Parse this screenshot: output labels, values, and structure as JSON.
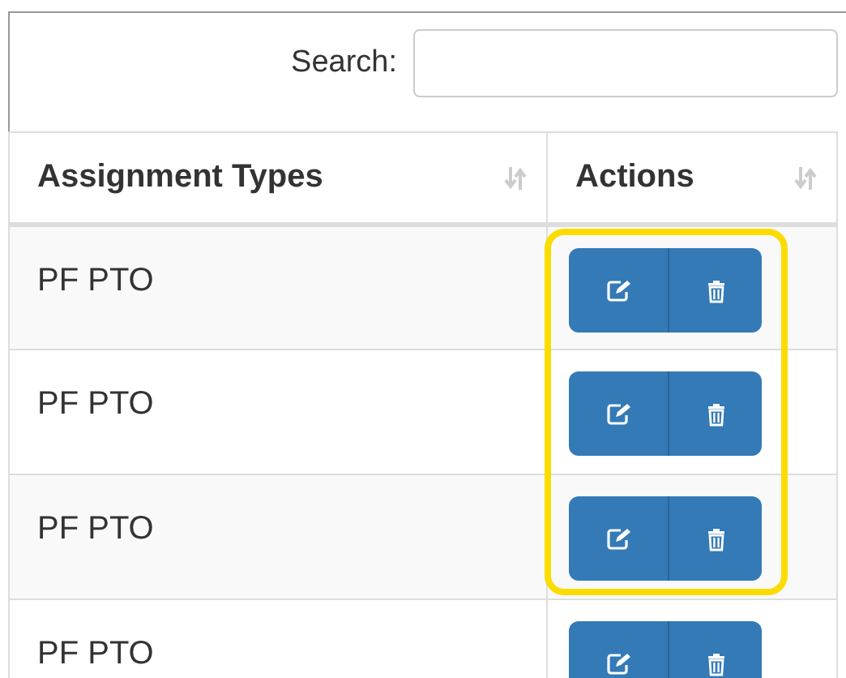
{
  "search": {
    "label": "Search:"
  },
  "table": {
    "columns": [
      {
        "label": "Assignment Types"
      },
      {
        "label": "Actions"
      }
    ],
    "rows": [
      {
        "type": "PF PTO",
        "highlighted": true
      },
      {
        "type": "PF PTO",
        "highlighted": true
      },
      {
        "type": "PF PTO",
        "highlighted": true
      },
      {
        "type": "PF PTO",
        "highlighted": false
      }
    ]
  }
}
